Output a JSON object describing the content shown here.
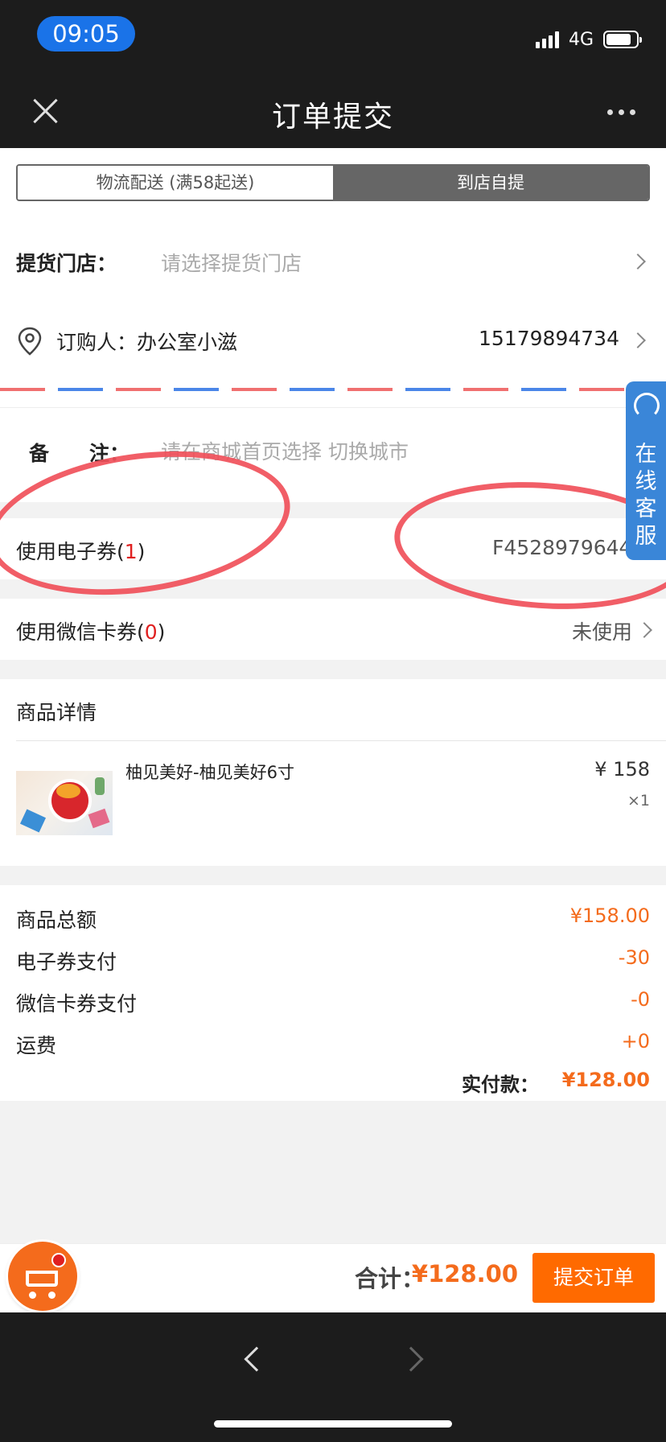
{
  "status_bar": {
    "time": "09:05",
    "network": "4G"
  },
  "nav": {
    "title": "订单提交"
  },
  "delivery_tabs": [
    {
      "label": "物流配送 (满58起送)",
      "active": false
    },
    {
      "label": "到店自提",
      "active": true
    }
  ],
  "pickup": {
    "label": "提货门店：",
    "placeholder": "请选择提货门店"
  },
  "buyer": {
    "label": "订购人：办公室小滋",
    "phone": "15179894734"
  },
  "remark": {
    "label": "备　　注：",
    "placeholder": "请在商城首页选择 切换城市"
  },
  "e_voucher": {
    "label_prefix": "使用电子券(",
    "count": "1",
    "label_suffix": ")",
    "value": "F45289796444"
  },
  "wechat_card": {
    "label_prefix": "使用微信卡券(",
    "count": "0",
    "label_suffix": ")",
    "value": "未使用"
  },
  "product_section": {
    "title": "商品详情",
    "item": {
      "name": "柚见美好-柚见美好6寸",
      "price": "¥ 158",
      "qty": "×1"
    }
  },
  "summary": {
    "rows": [
      {
        "label": "商品总额",
        "value": "¥158.00"
      },
      {
        "label": "电子券支付",
        "value": "-30"
      },
      {
        "label": "微信卡券支付",
        "value": "-0"
      },
      {
        "label": "运费",
        "value": "+0"
      }
    ],
    "paid_label": "实付款：",
    "paid_value": "¥128.00"
  },
  "service_tab": {
    "label": "在线客服"
  },
  "bottom": {
    "total_label": "合计：",
    "total_value": "¥128.00",
    "submit": "提交订单"
  },
  "colors": {
    "accent": "#ff6a00",
    "price": "#f46b1c",
    "annotation": "#f0505a",
    "service": "#3a86d8"
  }
}
